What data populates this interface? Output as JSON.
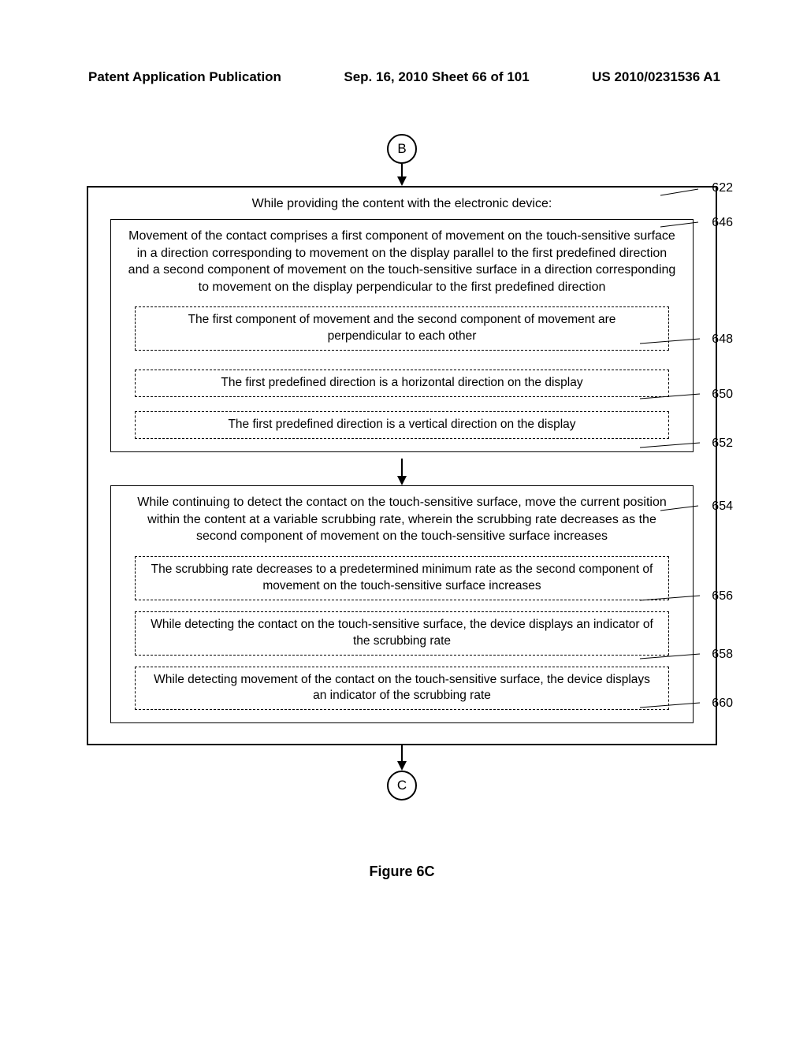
{
  "header": {
    "left": "Patent Application Publication",
    "center": "Sep. 16, 2010  Sheet 66 of 101",
    "right": "US 2010/0231536 A1"
  },
  "connectors": {
    "top": "B",
    "bottom": "C"
  },
  "outer_title": "While providing the content with the electronic device:",
  "box646": {
    "text": "Movement of the contact comprises a first component of movement on the touch-sensitive surface in a direction corresponding to movement on the display parallel to the first predefined direction and a second component of movement on the touch-sensitive surface in a direction corresponding to movement on the display perpendicular to the first predefined direction",
    "ref": "646"
  },
  "box648": {
    "text": "The first component of movement and the second component of movement are perpendicular to each other",
    "ref": "648"
  },
  "box650": {
    "text": "The first predefined direction is a horizontal direction on the display",
    "ref": "650"
  },
  "box652": {
    "text": "The first predefined direction is a vertical direction on the display",
    "ref": "652"
  },
  "box654": {
    "text": "While continuing to detect the contact on the touch-sensitive surface, move the current position within the content at a variable scrubbing rate, wherein the scrubbing rate decreases as the second component of movement on the touch-sensitive surface increases",
    "ref": "654"
  },
  "box656": {
    "text": "The scrubbing rate decreases to a predetermined minimum rate as the second component of movement on the touch-sensitive surface increases",
    "ref": "656"
  },
  "box658": {
    "text": "While detecting the contact on the touch-sensitive surface, the device displays an indicator of the scrubbing rate",
    "ref": "658"
  },
  "box660": {
    "text": "While detecting movement of the contact on the touch-sensitive surface, the device displays an indicator of the scrubbing rate",
    "ref": "660"
  },
  "ref622": "622",
  "figure_caption": "Figure 6C"
}
